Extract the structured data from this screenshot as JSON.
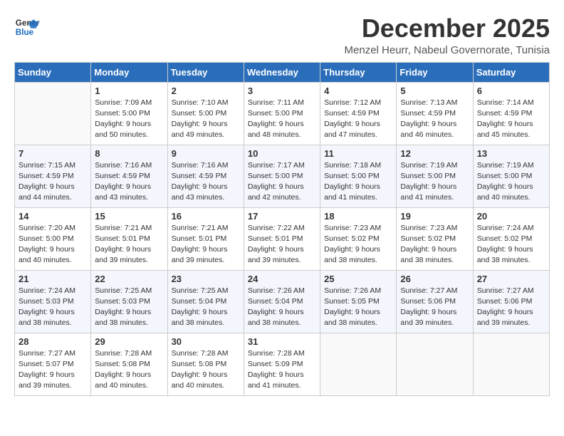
{
  "logo": {
    "line1": "General",
    "line2": "Blue"
  },
  "title": "December 2025",
  "subtitle": "Menzel Heurr, Nabeul Governorate, Tunisia",
  "headers": [
    "Sunday",
    "Monday",
    "Tuesday",
    "Wednesday",
    "Thursday",
    "Friday",
    "Saturday"
  ],
  "weeks": [
    [
      {
        "day": "",
        "info": ""
      },
      {
        "day": "1",
        "info": "Sunrise: 7:09 AM\nSunset: 5:00 PM\nDaylight: 9 hours\nand 50 minutes."
      },
      {
        "day": "2",
        "info": "Sunrise: 7:10 AM\nSunset: 5:00 PM\nDaylight: 9 hours\nand 49 minutes."
      },
      {
        "day": "3",
        "info": "Sunrise: 7:11 AM\nSunset: 5:00 PM\nDaylight: 9 hours\nand 48 minutes."
      },
      {
        "day": "4",
        "info": "Sunrise: 7:12 AM\nSunset: 4:59 PM\nDaylight: 9 hours\nand 47 minutes."
      },
      {
        "day": "5",
        "info": "Sunrise: 7:13 AM\nSunset: 4:59 PM\nDaylight: 9 hours\nand 46 minutes."
      },
      {
        "day": "6",
        "info": "Sunrise: 7:14 AM\nSunset: 4:59 PM\nDaylight: 9 hours\nand 45 minutes."
      }
    ],
    [
      {
        "day": "7",
        "info": "Sunrise: 7:15 AM\nSunset: 4:59 PM\nDaylight: 9 hours\nand 44 minutes."
      },
      {
        "day": "8",
        "info": "Sunrise: 7:16 AM\nSunset: 4:59 PM\nDaylight: 9 hours\nand 43 minutes."
      },
      {
        "day": "9",
        "info": "Sunrise: 7:16 AM\nSunset: 4:59 PM\nDaylight: 9 hours\nand 43 minutes."
      },
      {
        "day": "10",
        "info": "Sunrise: 7:17 AM\nSunset: 5:00 PM\nDaylight: 9 hours\nand 42 minutes."
      },
      {
        "day": "11",
        "info": "Sunrise: 7:18 AM\nSunset: 5:00 PM\nDaylight: 9 hours\nand 41 minutes."
      },
      {
        "day": "12",
        "info": "Sunrise: 7:19 AM\nSunset: 5:00 PM\nDaylight: 9 hours\nand 41 minutes."
      },
      {
        "day": "13",
        "info": "Sunrise: 7:19 AM\nSunset: 5:00 PM\nDaylight: 9 hours\nand 40 minutes."
      }
    ],
    [
      {
        "day": "14",
        "info": "Sunrise: 7:20 AM\nSunset: 5:00 PM\nDaylight: 9 hours\nand 40 minutes."
      },
      {
        "day": "15",
        "info": "Sunrise: 7:21 AM\nSunset: 5:01 PM\nDaylight: 9 hours\nand 39 minutes."
      },
      {
        "day": "16",
        "info": "Sunrise: 7:21 AM\nSunset: 5:01 PM\nDaylight: 9 hours\nand 39 minutes."
      },
      {
        "day": "17",
        "info": "Sunrise: 7:22 AM\nSunset: 5:01 PM\nDaylight: 9 hours\nand 39 minutes."
      },
      {
        "day": "18",
        "info": "Sunrise: 7:23 AM\nSunset: 5:02 PM\nDaylight: 9 hours\nand 38 minutes."
      },
      {
        "day": "19",
        "info": "Sunrise: 7:23 AM\nSunset: 5:02 PM\nDaylight: 9 hours\nand 38 minutes."
      },
      {
        "day": "20",
        "info": "Sunrise: 7:24 AM\nSunset: 5:02 PM\nDaylight: 9 hours\nand 38 minutes."
      }
    ],
    [
      {
        "day": "21",
        "info": "Sunrise: 7:24 AM\nSunset: 5:03 PM\nDaylight: 9 hours\nand 38 minutes."
      },
      {
        "day": "22",
        "info": "Sunrise: 7:25 AM\nSunset: 5:03 PM\nDaylight: 9 hours\nand 38 minutes."
      },
      {
        "day": "23",
        "info": "Sunrise: 7:25 AM\nSunset: 5:04 PM\nDaylight: 9 hours\nand 38 minutes."
      },
      {
        "day": "24",
        "info": "Sunrise: 7:26 AM\nSunset: 5:04 PM\nDaylight: 9 hours\nand 38 minutes."
      },
      {
        "day": "25",
        "info": "Sunrise: 7:26 AM\nSunset: 5:05 PM\nDaylight: 9 hours\nand 38 minutes."
      },
      {
        "day": "26",
        "info": "Sunrise: 7:27 AM\nSunset: 5:06 PM\nDaylight: 9 hours\nand 39 minutes."
      },
      {
        "day": "27",
        "info": "Sunrise: 7:27 AM\nSunset: 5:06 PM\nDaylight: 9 hours\nand 39 minutes."
      }
    ],
    [
      {
        "day": "28",
        "info": "Sunrise: 7:27 AM\nSunset: 5:07 PM\nDaylight: 9 hours\nand 39 minutes."
      },
      {
        "day": "29",
        "info": "Sunrise: 7:28 AM\nSunset: 5:08 PM\nDaylight: 9 hours\nand 40 minutes."
      },
      {
        "day": "30",
        "info": "Sunrise: 7:28 AM\nSunset: 5:08 PM\nDaylight: 9 hours\nand 40 minutes."
      },
      {
        "day": "31",
        "info": "Sunrise: 7:28 AM\nSunset: 5:09 PM\nDaylight: 9 hours\nand 41 minutes."
      },
      {
        "day": "",
        "info": ""
      },
      {
        "day": "",
        "info": ""
      },
      {
        "day": "",
        "info": ""
      }
    ]
  ]
}
